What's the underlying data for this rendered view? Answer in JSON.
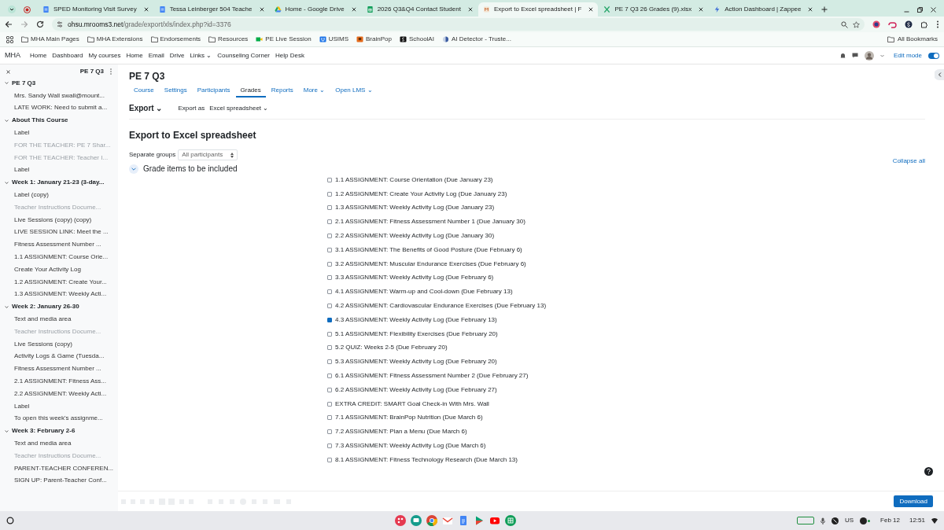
{
  "browser": {
    "tabs": [
      {
        "title": "SPED Monitoring Visit Survey",
        "selected": false
      },
      {
        "title": "Tessa Leinberger 504 Teache",
        "selected": false
      },
      {
        "title": "Home - Google Drive",
        "selected": false
      },
      {
        "title": "2026 Q3&Q4 Contact Student",
        "selected": false
      },
      {
        "title": "Export to Excel spreadsheet | F",
        "selected": true
      },
      {
        "title": "PE 7 Q3 26 Grades (9).xlsx",
        "selected": false
      },
      {
        "title": "Action Dashboard | Zappee",
        "selected": false
      }
    ],
    "url_host": "ohsu.mrooms3.net",
    "url_path": "/grade/export/xls/index.php?id=3376",
    "bookmarks": [
      "MHA Main Pages",
      "MHA Extensions",
      "Endorsements",
      "Resources",
      "PE Live Session",
      "USIMS",
      "BrainPop",
      "SchoolAI",
      "AI Detector - Truste..."
    ],
    "all_bookmarks": "All Bookmarks"
  },
  "site": {
    "brand": "MHA",
    "nav": [
      "Home",
      "Dashboard",
      "My courses",
      "Home",
      "Email",
      "Drive",
      "Links ⌄",
      "Counseling Corner",
      "Help Desk"
    ],
    "edit_mode": {
      "label": "Edit mode",
      "on": true
    }
  },
  "sidebar": {
    "title": "PE 7 Q3",
    "sections": [
      {
        "title": "PE 7 Q3",
        "children": [
          {
            "label": "Mrs. Sandy Wall swall@mount...",
            "hidden": false
          },
          {
            "label": "LATE WORK: Need to submit a...",
            "hidden": false
          }
        ]
      },
      {
        "title": "About This Course",
        "children": [
          {
            "label": "Label",
            "hidden": false
          },
          {
            "label": "FOR THE TEACHER: PE 7 Shar...",
            "hidden": true
          },
          {
            "label": "FOR THE TEACHER: Teacher I...",
            "hidden": true
          },
          {
            "label": "Label",
            "hidden": false
          }
        ]
      },
      {
        "title": "Week 1: January 21-23 (3-day...",
        "children": [
          {
            "label": "Label (copy)",
            "hidden": false
          },
          {
            "label": "Teacher Instructions Docume...",
            "hidden": true
          },
          {
            "label": "Live Sessions (copy) (copy)",
            "hidden": false
          },
          {
            "label": "LIVE SESSION LINK: Meet the ...",
            "hidden": false
          },
          {
            "label": "Fitness Assessment Number ...",
            "hidden": false
          },
          {
            "label": "1.1 ASSIGNMENT: Course Orie...",
            "hidden": false
          },
          {
            "label": "Create Your Activity Log",
            "hidden": false
          },
          {
            "label": "1.2 ASSIGNMENT: Create Your...",
            "hidden": false
          },
          {
            "label": "1.3 ASSIGNMENT: Weekly Acti...",
            "hidden": false
          }
        ]
      },
      {
        "title": "Week 2: January 26-30",
        "children": [
          {
            "label": "Text and media area",
            "hidden": false
          },
          {
            "label": "Teacher Instructions Docume...",
            "hidden": true
          },
          {
            "label": "Live Sessions (copy)",
            "hidden": false
          },
          {
            "label": "Activity Logs & Game (Tuesda...",
            "hidden": false
          },
          {
            "label": "Fitness Assessment Number ...",
            "hidden": false
          },
          {
            "label": "2.1 ASSIGNMENT: Fitness Ass...",
            "hidden": false
          },
          {
            "label": "2.2 ASSIGNMENT: Weekly Acti...",
            "hidden": false
          },
          {
            "label": "Label",
            "hidden": false
          },
          {
            "label": "To open this week's assignme...",
            "hidden": false
          }
        ]
      },
      {
        "title": "Week 3: February 2-6",
        "children": [
          {
            "label": "Text and media area",
            "hidden": false
          },
          {
            "label": "Teacher Instructions Docume...",
            "hidden": true
          },
          {
            "label": "PARENT-TEACHER CONFEREN...",
            "hidden": false
          },
          {
            "label": "SIGN UP: Parent-Teacher Conf...",
            "hidden": false
          }
        ]
      }
    ]
  },
  "page": {
    "title": "PE 7 Q3",
    "tabs": [
      {
        "label": "Course",
        "selected": false
      },
      {
        "label": "Settings",
        "selected": false
      },
      {
        "label": "Participants",
        "selected": false
      },
      {
        "label": "Grades",
        "selected": true
      },
      {
        "label": "Reports",
        "selected": false
      },
      {
        "label": "More ⌄",
        "selected": false
      },
      {
        "label": "Open LMS ⌄",
        "selected": false
      }
    ],
    "export_menu": "Export ⌄",
    "export_as_label": "Export as",
    "export_as_value": "Excel spreadsheet ⌄",
    "heading": "Export to Excel spreadsheet",
    "groups_label": "Separate groups",
    "groups_value": "All participants",
    "collapse_all": "Collapse all",
    "section_title": "Grade items to be included",
    "items": [
      {
        "label": "1.1 ASSIGNMENT: Course Orientation (Due January 23)",
        "checked": false
      },
      {
        "label": "1.2 ASSIGNMENT: Create Your Activity Log (Due January 23)",
        "checked": false
      },
      {
        "label": "1.3 ASSIGNMENT: Weekly Activity Log (Due January 23)",
        "checked": false
      },
      {
        "label": "2.1 ASSIGNMENT: Fitness Assessment Number 1 (Due January 30)",
        "checked": false
      },
      {
        "label": "2.2 ASSIGNMENT: Weekly Activity Log (Due January 30)",
        "checked": false
      },
      {
        "label": "3.1 ASSIGNMENT: The Benefits of Good Posture (Due February 6)",
        "checked": false
      },
      {
        "label": "3.2 ASSIGNMENT: Muscular Endurance Exercises (Due February 6)",
        "checked": false
      },
      {
        "label": "3.3 ASSIGNMENT: Weekly Activity Log (Due February 6)",
        "checked": false
      },
      {
        "label": "4.1 ASSIGNMENT: Warm-up and Cool-down (Due February 13)",
        "checked": false
      },
      {
        "label": "4.2 ASSIGNMENT: Cardiovascular Endurance Exercises (Due February 13)",
        "checked": false
      },
      {
        "label": "4.3 ASSIGNMENT: Weekly Activity Log (Due February 13)",
        "checked": true
      },
      {
        "label": "5.1 ASSIGNMENT: Flexibility Exercises (Due February 20)",
        "checked": false
      },
      {
        "label": "5.2 QUIZ: Weeks 2-5 (Due February 20)",
        "checked": false
      },
      {
        "label": "5.3 ASSIGNMENT: Weekly Activity Log (Due February 20)",
        "checked": false
      },
      {
        "label": "6.1 ASSIGNMENT: Fitness Assessment Number 2 (Due February 27)",
        "checked": false
      },
      {
        "label": "6.2 ASSIGNMENT: Weekly Activity Log (Due February 27)",
        "checked": false
      },
      {
        "label": "EXTRA CREDIT: SMART Goal Check-in With Mrs. Wall",
        "checked": false
      },
      {
        "label": "7.1 ASSIGNMENT: BrainPop Nutrition (Due March 6)",
        "checked": false
      },
      {
        "label": "7.2 ASSIGNMENT: Plan a Menu (Due March 6)",
        "checked": false
      },
      {
        "label": "7.3 ASSIGNMENT: Weekly Activity Log (Due March 6)",
        "checked": false
      },
      {
        "label": "8.1 ASSIGNMENT: Fitness Technology Research (Due March 13)",
        "checked": false
      }
    ],
    "download": "Download"
  },
  "taskbar": {
    "language": "US",
    "date": "Feb 12",
    "time": "12:51"
  }
}
